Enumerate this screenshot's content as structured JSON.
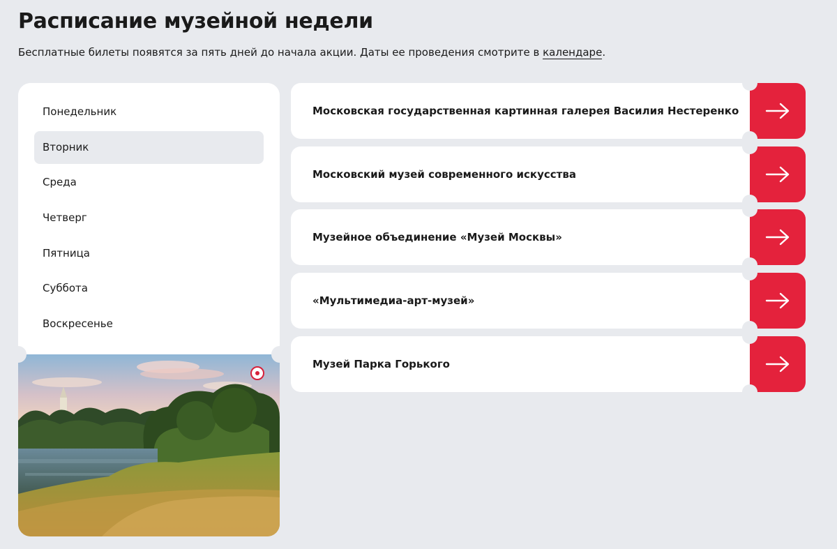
{
  "header": {
    "title": "Расписание музейной недели",
    "subtitle_text": "Бесплатные билеты появятся за пять дней до начала акции. Даты ее проведения смотрите в ",
    "subtitle_link": "календаре",
    "subtitle_end": "."
  },
  "days": {
    "active_index": 1,
    "items": [
      {
        "label": "Понедельник"
      },
      {
        "label": "Вторник"
      },
      {
        "label": "Среда"
      },
      {
        "label": "Четверг"
      },
      {
        "label": "Пятница"
      },
      {
        "label": "Суббота"
      },
      {
        "label": "Воскресенье"
      }
    ]
  },
  "museums": [
    {
      "name": "Московская государственная картинная галерея Василия Нестеренко"
    },
    {
      "name": "Московский музей современного искусства"
    },
    {
      "name": "Музейное объединение «Музей Москвы»"
    },
    {
      "name": "«Мультимедиа-арт-музей»"
    },
    {
      "name": "Музей Парка Горького"
    }
  ],
  "colors": {
    "background": "#e8eaee",
    "accent": "#e4223c",
    "card": "#ffffff",
    "active_day": "#e8eaee"
  },
  "icons": {
    "arrow": "arrow-right-icon",
    "photo_badge": "record-dot-icon"
  }
}
